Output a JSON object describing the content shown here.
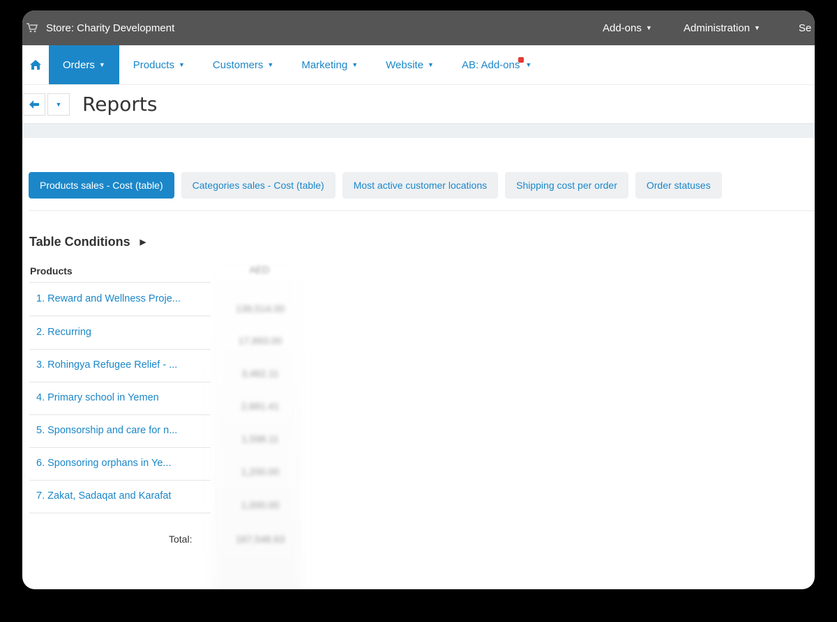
{
  "topbar": {
    "store_label": "Store: Charity Development",
    "addons": "Add-ons",
    "administration": "Administration",
    "settings_partial": "Se"
  },
  "nav": {
    "items": [
      {
        "label": "Orders",
        "active": true
      },
      {
        "label": "Products"
      },
      {
        "label": "Customers"
      },
      {
        "label": "Marketing"
      },
      {
        "label": "Website"
      },
      {
        "label": "AB: Add-ons"
      }
    ]
  },
  "page": {
    "title": "Reports"
  },
  "tabs": [
    {
      "label": "Products sales - Cost (table)",
      "active": true
    },
    {
      "label": "Categories sales - Cost (table)"
    },
    {
      "label": "Most active customer locations"
    },
    {
      "label": "Shipping cost per order"
    },
    {
      "label": "Order statuses"
    }
  ],
  "conditions": {
    "label": "Table Conditions"
  },
  "table": {
    "col_products": "Products",
    "col_currency": "AED",
    "rows": [
      {
        "name": "1. Reward and Wellness Proje...",
        "value": "139,514.00"
      },
      {
        "name": "2. Recurring",
        "value": "17,893.00"
      },
      {
        "name": "3. Rohingya Refugee Relief - ...",
        "value": "3,462.11"
      },
      {
        "name": "4. Primary school in Yemen",
        "value": "2,881.41"
      },
      {
        "name": "5. Sponsorship and care for n...",
        "value": "1,598.11"
      },
      {
        "name": "6. Sponsoring orphans in Ye...",
        "value": "1,200.00"
      },
      {
        "name": "7. Zakat, Sadaqat and Karafat",
        "value": "1,000.00"
      }
    ],
    "total_label": "Total:",
    "total_value": "167,548.63"
  },
  "colors": {
    "accent": "#1b87c9",
    "topbar": "#555555"
  }
}
